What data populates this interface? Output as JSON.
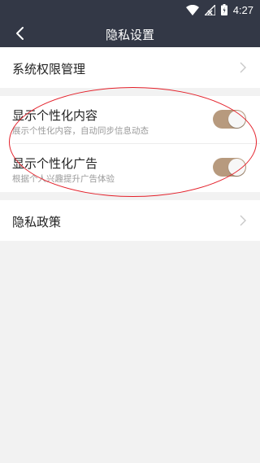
{
  "status": {
    "time": "4:27"
  },
  "header": {
    "title": "隐私设置"
  },
  "system_permissions": {
    "label": "系统权限管理"
  },
  "personalized_content": {
    "label": "显示个性化内容",
    "description": "展示个性化内容，自动同步信息动态",
    "enabled": true
  },
  "personalized_ads": {
    "label": "显示个性化广告",
    "description": "根据个人兴趣提升广告体验",
    "enabled": true
  },
  "privacy_policy": {
    "label": "隐私政策"
  },
  "colors": {
    "header_bg": "#333846",
    "toggle_on": "#b79a7e",
    "annotation": "#e4202a",
    "page_bg": "#f2f2f2"
  },
  "icons": {
    "back": "arrow-left",
    "chevron": "chevron-right",
    "wifi": "wifi",
    "signal": "cell-signal",
    "battery": "battery"
  }
}
